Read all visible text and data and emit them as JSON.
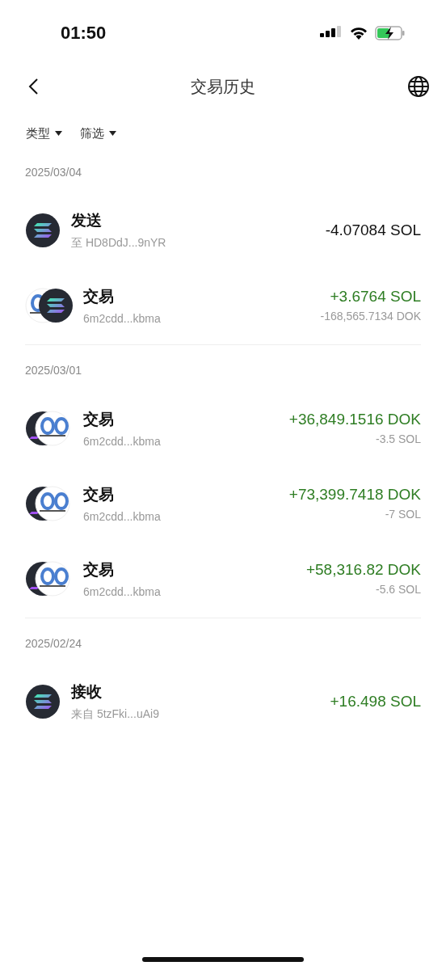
{
  "status_bar": {
    "time": "01:50"
  },
  "header": {
    "title": "交易历史"
  },
  "filters": [
    {
      "label": "类型"
    },
    {
      "label": "筛选"
    }
  ],
  "groups": [
    {
      "date": "2025/03/04",
      "rows": [
        {
          "kind": "single",
          "title": "发送",
          "subtitle": "至 HD8DdJ...9nYR",
          "amount": "-4.07084 SOL",
          "positive": false
        },
        {
          "kind": "pair",
          "title": "交易",
          "subtitle": "6m2cdd...kbma",
          "amount": "+3.6764 SOL",
          "positive": true,
          "secondary": "-168,565.7134 DOK"
        }
      ]
    },
    {
      "date": "2025/03/01",
      "rows": [
        {
          "kind": "overlap",
          "title": "交易",
          "subtitle": "6m2cdd...kbma",
          "amount": "+36,849.1516 DOK",
          "positive": true,
          "secondary": "-3.5 SOL"
        },
        {
          "kind": "overlap",
          "title": "交易",
          "subtitle": "6m2cdd...kbma",
          "amount": "+73,399.7418 DOK",
          "positive": true,
          "secondary": "-7 SOL"
        },
        {
          "kind": "overlap",
          "title": "交易",
          "subtitle": "6m2cdd...kbma",
          "amount": "+58,316.82 DOK",
          "positive": true,
          "secondary": "-5.6 SOL"
        }
      ]
    },
    {
      "date": "2025/02/24",
      "rows": [
        {
          "kind": "single",
          "title": "接收",
          "subtitle": "来自 5tzFki...uAi9",
          "amount": "+16.498 SOL",
          "positive": true
        }
      ]
    }
  ]
}
